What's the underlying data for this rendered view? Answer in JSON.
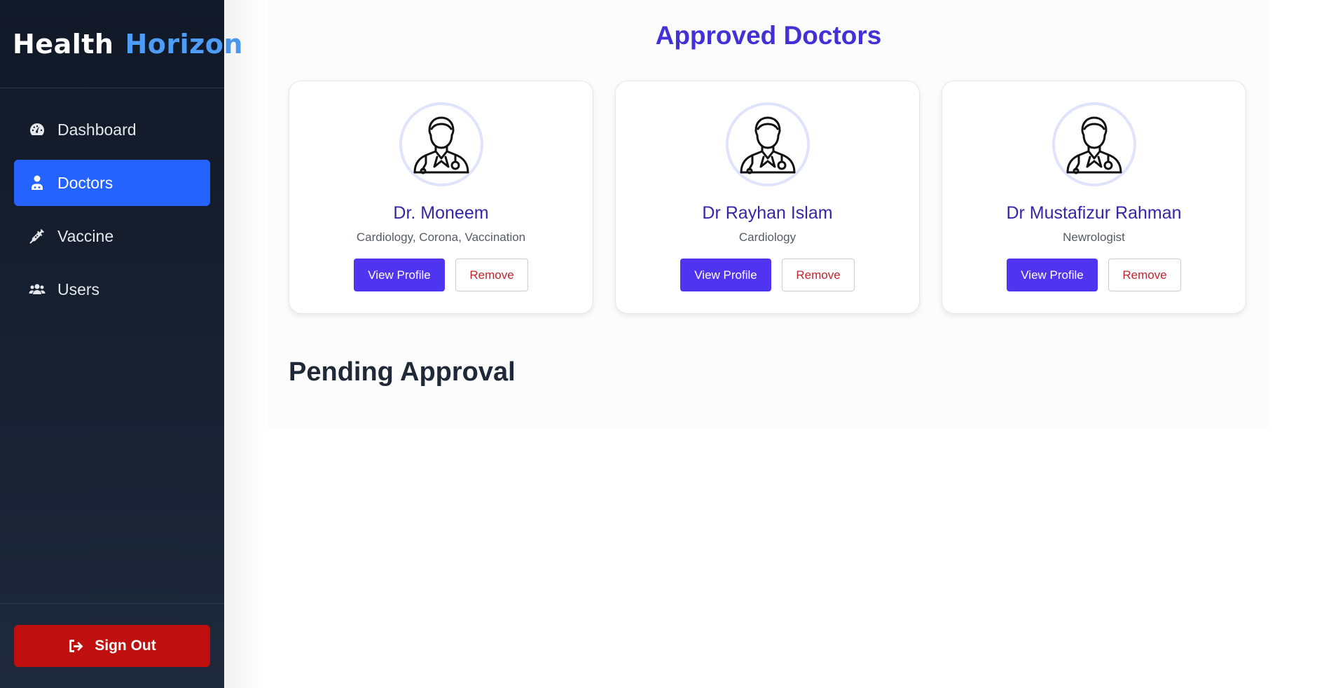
{
  "brand": {
    "part1": "Health",
    "part2": "Horizon"
  },
  "sidebar": {
    "items": [
      {
        "label": "Dashboard",
        "icon": "gauge-icon",
        "active": false
      },
      {
        "label": "Doctors",
        "icon": "user-doctor-icon",
        "active": true
      },
      {
        "label": "Vaccine",
        "icon": "syringe-icon",
        "active": false
      },
      {
        "label": "Users",
        "icon": "users-icon",
        "active": false
      }
    ],
    "signout_label": "Sign Out",
    "signout_icon": "sign-out-icon"
  },
  "main": {
    "title": "Approved Doctors",
    "doctors": [
      {
        "name": "Dr. Moneem",
        "specialty": "Cardiology, Corona, Vaccination",
        "view_label": "View Profile",
        "remove_label": "Remove"
      },
      {
        "name": "Dr Rayhan Islam",
        "specialty": "Cardiology",
        "view_label": "View Profile",
        "remove_label": "Remove"
      },
      {
        "name": "Dr Mustafizur Rahman",
        "specialty": "Newrologist",
        "view_label": "View Profile",
        "remove_label": "Remove"
      }
    ],
    "pending_title": "Pending Approval"
  },
  "colors": {
    "accent": "#2563ff",
    "title": "#4330d6",
    "view_button": "#4f35f0",
    "signout": "#c00f0f",
    "brand_highlight": "#4d9cf5"
  }
}
